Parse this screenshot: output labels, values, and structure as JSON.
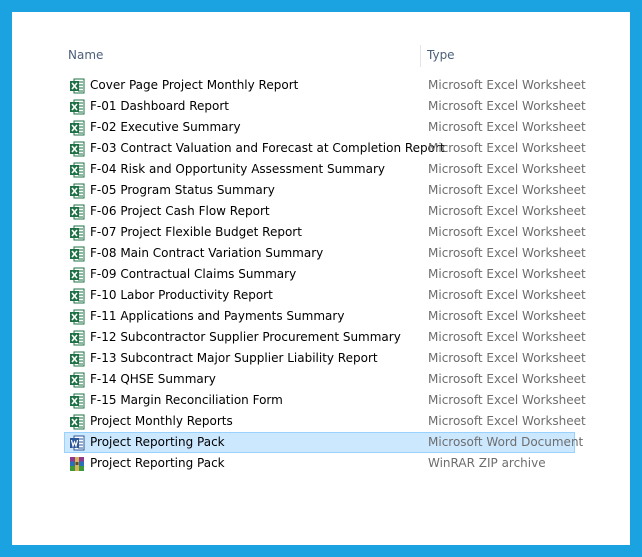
{
  "columns": {
    "name": "Name",
    "type": "Type"
  },
  "colors": {
    "frame": "#1aa3e0",
    "selection": "#cce8ff",
    "excel": "#1e7145",
    "word": "#2b579a"
  },
  "files": [
    {
      "name": "Cover Page Project Monthly Report",
      "type": "Microsoft Excel Worksheet",
      "icon": "excel-icon"
    },
    {
      "name": "F-01 Dashboard Report",
      "type": "Microsoft Excel Worksheet",
      "icon": "excel-icon"
    },
    {
      "name": "F-02 Executive Summary",
      "type": "Microsoft Excel Worksheet",
      "icon": "excel-icon"
    },
    {
      "name": "F-03 Contract Valuation and Forecast at Completion Report",
      "type": "Microsoft Excel Worksheet",
      "icon": "excel-icon"
    },
    {
      "name": "F-04 Risk and Opportunity Assessment Summary",
      "type": "Microsoft Excel Worksheet",
      "icon": "excel-icon"
    },
    {
      "name": "F-05 Program Status Summary",
      "type": "Microsoft Excel Worksheet",
      "icon": "excel-icon"
    },
    {
      "name": "F-06 Project Cash Flow Report",
      "type": "Microsoft Excel Worksheet",
      "icon": "excel-icon"
    },
    {
      "name": "F-07 Project Flexible Budget Report",
      "type": "Microsoft Excel Worksheet",
      "icon": "excel-icon"
    },
    {
      "name": "F-08 Main Contract Variation Summary",
      "type": "Microsoft Excel Worksheet",
      "icon": "excel-icon"
    },
    {
      "name": "F-09 Contractual Claims Summary",
      "type": "Microsoft Excel Worksheet",
      "icon": "excel-icon"
    },
    {
      "name": "F-10 Labor Productivity Report",
      "type": "Microsoft Excel Worksheet",
      "icon": "excel-icon"
    },
    {
      "name": "F-11 Applications and Payments Summary",
      "type": "Microsoft Excel Worksheet",
      "icon": "excel-icon"
    },
    {
      "name": "F-12 Subcontractor Supplier Procurement Summary",
      "type": "Microsoft Excel Worksheet",
      "icon": "excel-icon"
    },
    {
      "name": "F-13 Subcontract Major Supplier Liability Report",
      "type": "Microsoft Excel Worksheet",
      "icon": "excel-icon"
    },
    {
      "name": "F-14 QHSE Summary",
      "type": "Microsoft Excel Worksheet",
      "icon": "excel-icon"
    },
    {
      "name": "F-15 Margin Reconciliation Form",
      "type": "Microsoft Excel Worksheet",
      "icon": "excel-icon"
    },
    {
      "name": "Project Monthly Reports",
      "type": "Microsoft Excel Worksheet",
      "icon": "excel-icon"
    },
    {
      "name": "Project Reporting Pack",
      "type": "Microsoft Word Document",
      "icon": "word-icon",
      "selected": true
    },
    {
      "name": "Project Reporting Pack",
      "type": "WinRAR ZIP archive",
      "icon": "winrar-icon"
    }
  ]
}
